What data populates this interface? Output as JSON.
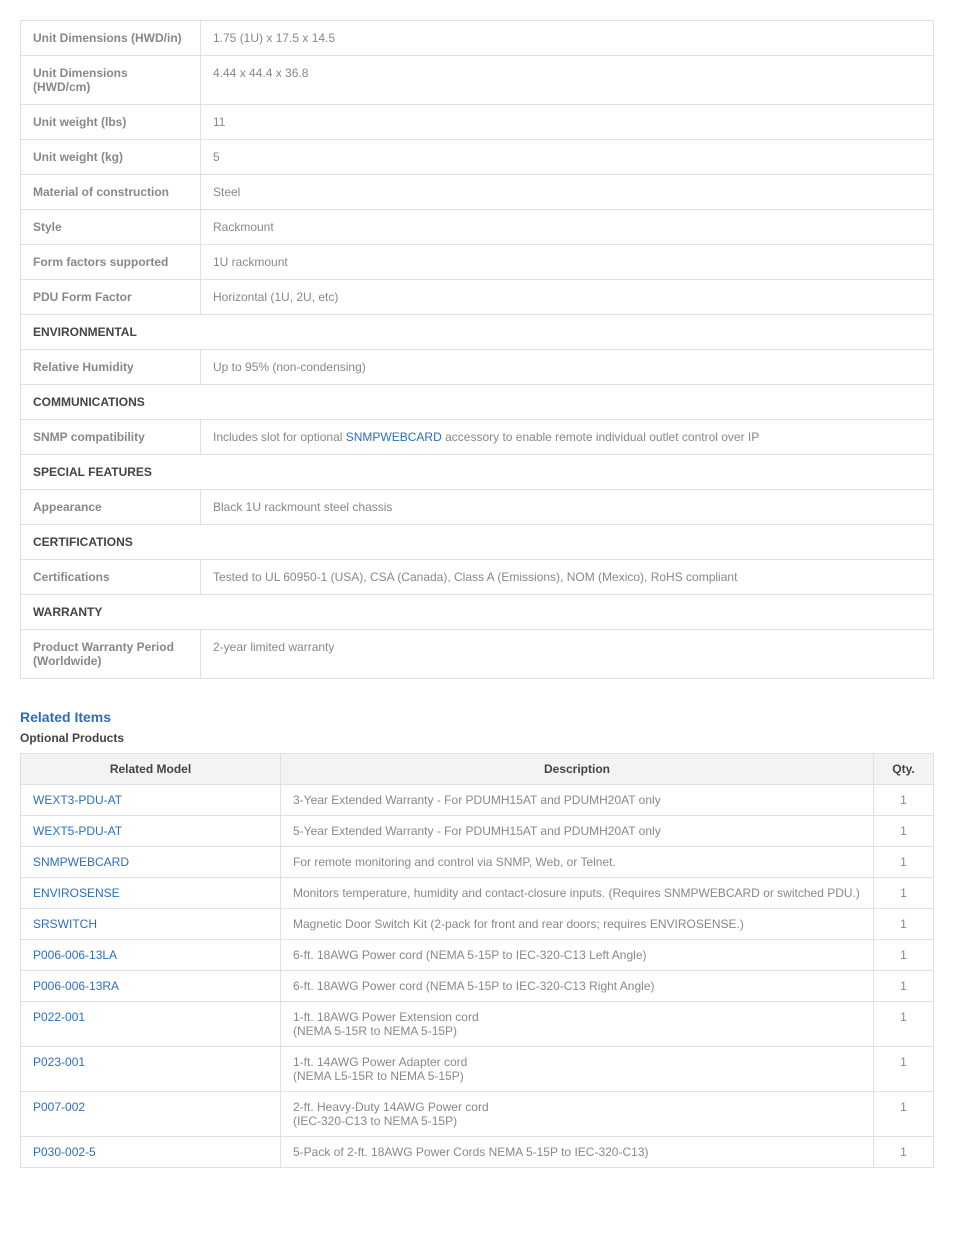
{
  "specs": {
    "rows": [
      {
        "type": "data",
        "label": "Unit Dimensions (HWD/in)",
        "value": "1.75 (1U) x 17.5 x 14.5"
      },
      {
        "type": "data",
        "label": "Unit Dimensions (HWD/cm)",
        "value": "4.44 x 44.4 x 36.8"
      },
      {
        "type": "data",
        "label": "Unit weight (lbs)",
        "value": "11"
      },
      {
        "type": "data",
        "label": "Unit weight (kg)",
        "value": "5"
      },
      {
        "type": "data",
        "label": "Material of construction",
        "value": "Steel"
      },
      {
        "type": "data",
        "label": "Style",
        "value": "Rackmount"
      },
      {
        "type": "data",
        "label": "Form factors supported",
        "value": "1U rackmount"
      },
      {
        "type": "data",
        "label": "PDU Form Factor",
        "value": "Horizontal (1U, 2U, etc)"
      },
      {
        "type": "section",
        "label": "ENVIRONMENTAL"
      },
      {
        "type": "data",
        "label": "Relative Humidity",
        "value": "Up to 95% (non-condensing)"
      },
      {
        "type": "section",
        "label": "COMMUNICATIONS"
      },
      {
        "type": "snmp",
        "label": "SNMP compatibility",
        "value_pre": "Includes slot for optional ",
        "value_link": "SNMPWEBCARD",
        "value_post": " accessory to enable remote individual outlet control over IP"
      },
      {
        "type": "section",
        "label": "SPECIAL FEATURES"
      },
      {
        "type": "data",
        "label": "Appearance",
        "value": "Black 1U rackmount steel chassis"
      },
      {
        "type": "section",
        "label": "CERTIFICATIONS"
      },
      {
        "type": "data",
        "label": "Certifications",
        "value": "Tested to UL 60950-1 (USA), CSA (Canada), Class A (Emissions), NOM (Mexico), RoHS compliant"
      },
      {
        "type": "section",
        "label": "WARRANTY"
      },
      {
        "type": "data",
        "label": "Product Warranty Period (Worldwide)",
        "value": "2-year limited warranty"
      }
    ]
  },
  "related": {
    "heading": "Related Items",
    "subheading": "Optional Products",
    "columns": {
      "model": "Related Model",
      "desc": "Description",
      "qty": "Qty."
    },
    "items": [
      {
        "model": "WEXT3-PDU-AT",
        "desc": "3-Year Extended Warranty - For PDUMH15AT and PDUMH20AT only",
        "qty": "1"
      },
      {
        "model": "WEXT5-PDU-AT",
        "desc": "5-Year Extended Warranty - For PDUMH15AT and PDUMH20AT only",
        "qty": "1"
      },
      {
        "model": "SNMPWEBCARD",
        "desc": "For remote monitoring and control via SNMP, Web, or Telnet.",
        "qty": "1"
      },
      {
        "model": "ENVIROSENSE",
        "desc": "Monitors temperature, humidity and contact-closure inputs. (Requires SNMPWEBCARD or switched PDU.)",
        "qty": "1"
      },
      {
        "model": "SRSWITCH",
        "desc": "Magnetic Door Switch Kit (2-pack for front and rear doors; requires ENVIROSENSE.)",
        "qty": "1"
      },
      {
        "model": "P006-006-13LA",
        "desc": "6-ft. 18AWG Power cord (NEMA 5-15P to IEC-320-C13 Left Angle)",
        "qty": "1"
      },
      {
        "model": "P006-006-13RA",
        "desc": "6-ft. 18AWG Power cord (NEMA 5-15P to IEC-320-C13 Right Angle)",
        "qty": "1"
      },
      {
        "model": "P022-001",
        "desc": "1-ft. 18AWG Power Extension cord\n(NEMA 5-15R to NEMA 5-15P)",
        "qty": "1"
      },
      {
        "model": "P023-001",
        "desc": "1-ft. 14AWG Power Adapter cord\n(NEMA L5-15R to NEMA 5-15P)",
        "qty": "1"
      },
      {
        "model": "P007-002",
        "desc": "2-ft. Heavy-Duty 14AWG Power cord\n(IEC-320-C13 to NEMA 5-15P)",
        "qty": "1"
      },
      {
        "model": "P030-002-5",
        "desc": "5-Pack of 2-ft. 18AWG Power Cords NEMA 5-15P to IEC-320-C13)",
        "qty": "1"
      }
    ]
  }
}
